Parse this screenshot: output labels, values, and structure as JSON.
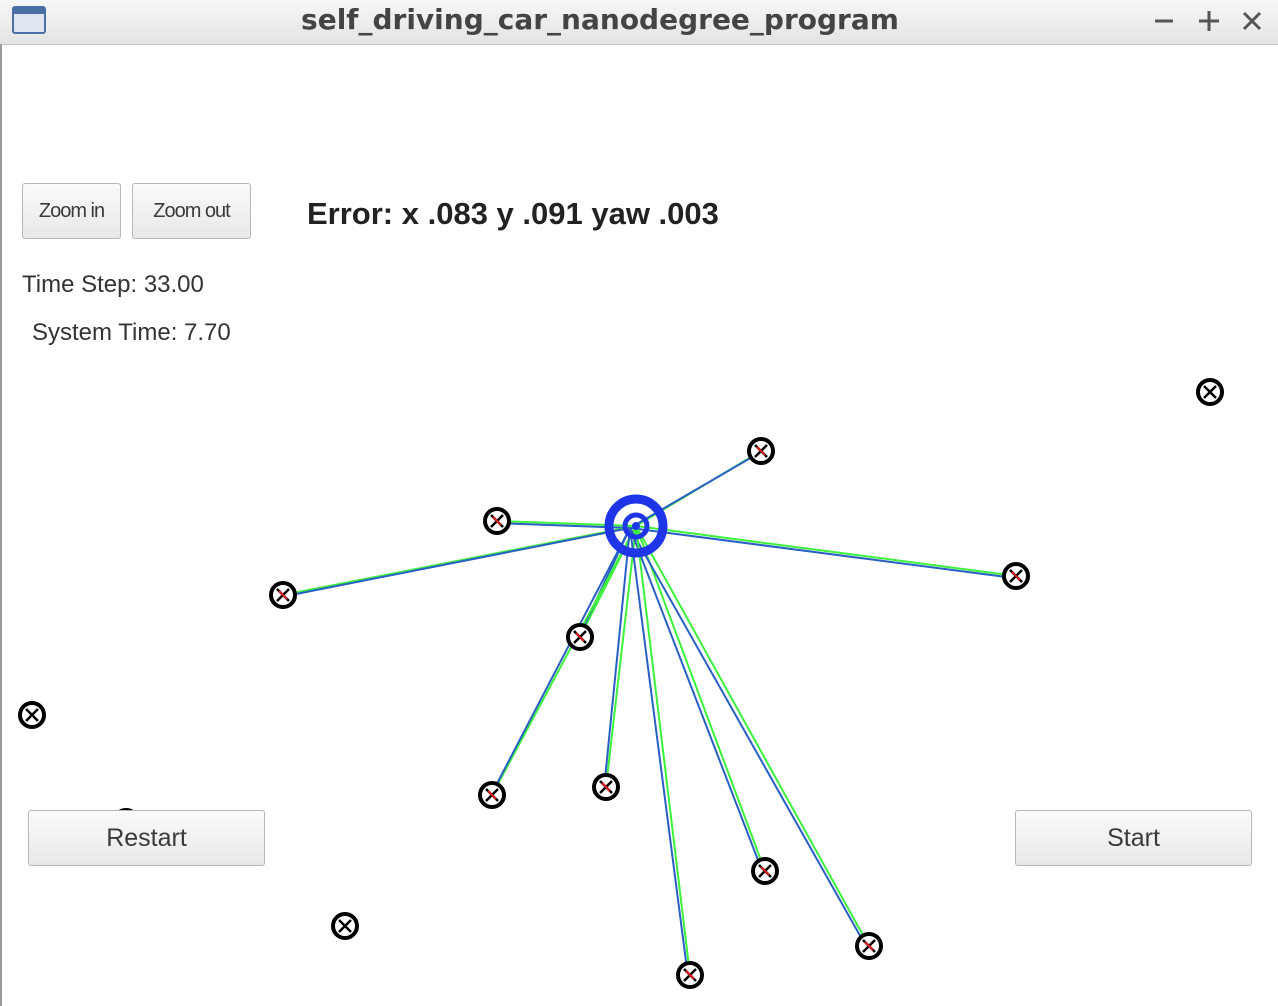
{
  "window": {
    "title": "self_driving_car_nanodegree_program",
    "controls": [
      "minimize-icon",
      "maximize-icon",
      "close-icon"
    ]
  },
  "toolbar": {
    "zoom_in_label": "Zoom in",
    "zoom_out_label": "Zoom out"
  },
  "status": {
    "error_text": "Error: x .083 y .091 yaw .003",
    "time_step_text": "Time Step: 33.00",
    "system_time_text": "System Time: 7.70"
  },
  "controls": {
    "restart_label": "Restart",
    "start_label": "Start"
  },
  "colors": {
    "car": "#1f35e8",
    "ground_truth_line": "#3cf23c",
    "estimate_line": "#2a5fc4",
    "landmark": "#000000",
    "observation_mark": "#e02020"
  },
  "icons": {
    "app": "window-icon",
    "landmark": "landmark-circle-x-icon",
    "car": "car-ring-icon"
  }
}
